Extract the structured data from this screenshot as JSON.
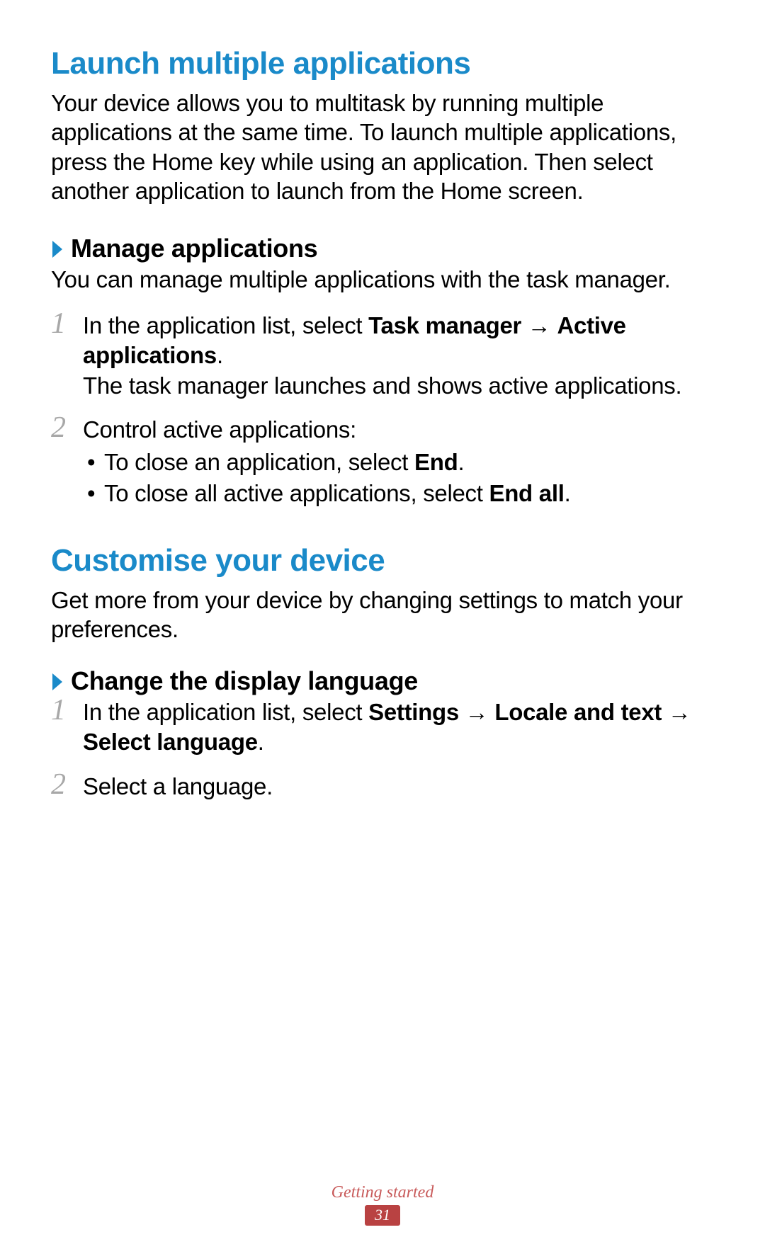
{
  "section1": {
    "heading": "Launch multiple applications",
    "body": "Your device allows you to multitask by running multiple applications at the same time. To launch multiple applications, press the Home key while using an application. Then select another application to launch from the Home screen.",
    "sub1": {
      "title": "Manage applications",
      "intro": "You can manage multiple applications with the task manager.",
      "step1_prefix": "In the application list, select ",
      "step1_bold1": "Task manager",
      "step1_arrow": " → ",
      "step1_bold2": "Active applications",
      "step1_period": ".",
      "step1_line2": "The task manager launches and shows active applications.",
      "step2_text": "Control active applications:",
      "bullet1_prefix": "To close an application, select ",
      "bullet1_bold": "End",
      "bullet1_period": ".",
      "bullet2_prefix": "To close all active applications, select ",
      "bullet2_bold": "End all",
      "bullet2_period": "."
    }
  },
  "section2": {
    "heading": "Customise your device",
    "body": "Get more from your device by changing settings to match your preferences.",
    "sub1": {
      "title": "Change the display language",
      "step1_prefix": "In the application list, select ",
      "step1_bold1": "Settings",
      "step1_arrow1": " → ",
      "step1_bold2": "Locale and text",
      "step1_arrow2": " → ",
      "step1_bold3": "Select language",
      "step1_period": ".",
      "step2_text": "Select a language."
    }
  },
  "numbers": {
    "one": "1",
    "two": "2"
  },
  "footer": {
    "chapter": "Getting started",
    "page": "31"
  }
}
